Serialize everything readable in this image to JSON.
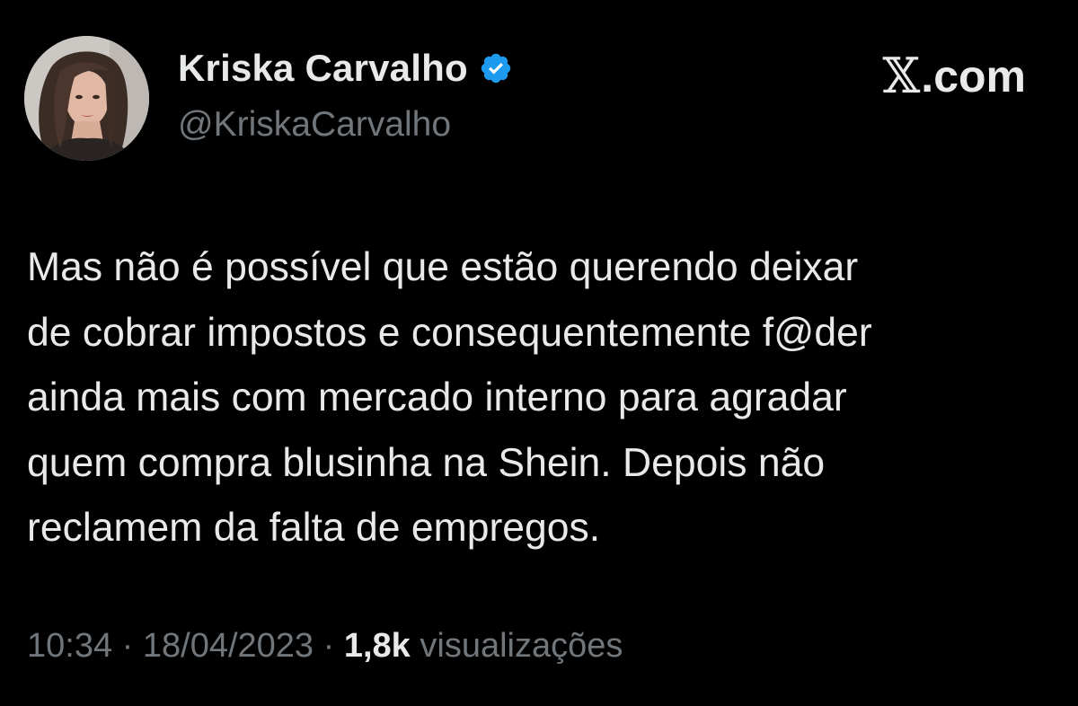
{
  "author": {
    "name": "Kriska Carvalho",
    "handle": "@KriskaCarvalho",
    "verified": true,
    "avatar_icon": "profile-photo"
  },
  "brand": {
    "symbol": "𝕏",
    "suffix": ".com"
  },
  "tweet": {
    "lines": [
      "Mas não é possível que estão querendo deixar",
      "de cobrar impostos e consequentemente f@der",
      "ainda mais com mercado interno para agradar",
      "quem compra blusinha na Shein. Depois não",
      "reclamem da falta de empregos."
    ]
  },
  "meta": {
    "time": "10:34",
    "separator": "·",
    "date": "18/04/2023",
    "views_count": "1,8k",
    "views_label": "visualizações"
  },
  "colors": {
    "background": "#000000",
    "text_primary": "#e7e9ea",
    "text_secondary": "#71767b",
    "verified_blue": "#1d9bf0"
  }
}
